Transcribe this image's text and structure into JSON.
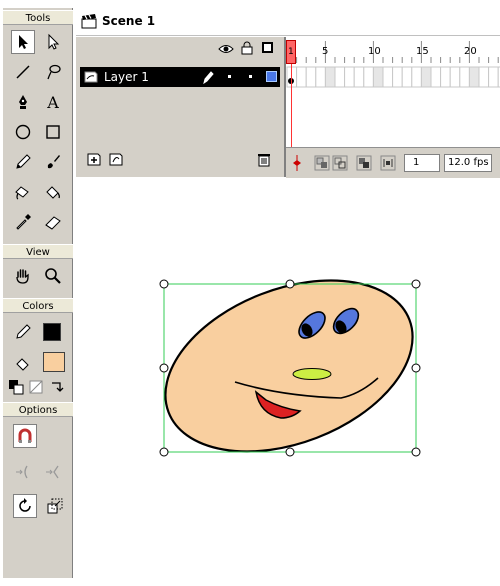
{
  "tools_panel": {
    "title": "Tools",
    "view_title": "View",
    "colors_title": "Colors",
    "options_title": "Options",
    "stroke_color": "#000000",
    "fill_color": "#f9cf9f"
  },
  "scene": {
    "label": "Scene 1"
  },
  "timeline": {
    "layer_name": "Layer 1",
    "frame_ticks": [
      "1",
      "5",
      "10",
      "15",
      "20"
    ],
    "current_frame": "1",
    "frame_rate": "12.0 fps"
  },
  "drawing": {
    "face_fill": "#f9cf9f",
    "eye_color": "#5577dd",
    "nose_color": "#ccee44",
    "mouth_color": "#dd2222",
    "selection_color": "#33cc55"
  }
}
